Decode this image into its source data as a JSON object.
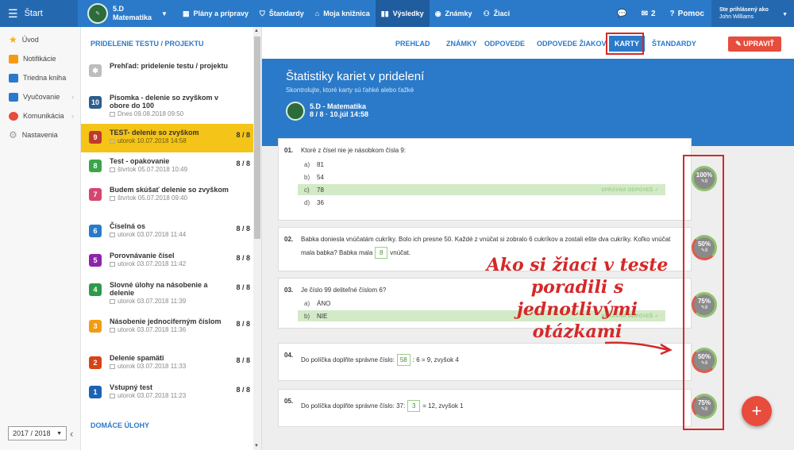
{
  "topbar": {
    "start_label": "Štart",
    "class_name": "5.D",
    "class_subject": "Matematika",
    "nav": [
      {
        "label": "Plány a prípravy",
        "icon": "calendar-icon"
      },
      {
        "label": "Štandardy",
        "icon": "shield-icon"
      },
      {
        "label": "Moja knižnica",
        "icon": "library-icon"
      },
      {
        "label": "Výsledky",
        "icon": "bar-chart-icon",
        "active": true
      },
      {
        "label": "Známky",
        "icon": "grade-icon"
      },
      {
        "label": "Žiaci",
        "icon": "students-icon"
      }
    ],
    "messages_count": "2",
    "help_label": "Pomoc",
    "user_caption": "Ste prihlásený ako",
    "user_name": "John Williams"
  },
  "sidebar": {
    "items": [
      {
        "label": "Úvod",
        "icon": "star-icon",
        "color": "#f5b400"
      },
      {
        "label": "Notifikácie",
        "icon": "envelope-icon",
        "color": "#f39c12"
      },
      {
        "label": "Triedna kniha",
        "icon": "book-icon",
        "color": "#2b7ac9"
      },
      {
        "label": "Vyučovanie",
        "icon": "teaching-icon",
        "color": "#2b7ac9",
        "arrow": "›"
      },
      {
        "label": "Komunikácia",
        "icon": "chat-icon",
        "color": "#e74c3c",
        "arrow": "›"
      },
      {
        "label": "Nastavenia",
        "icon": "gear-icon",
        "color": "#999999"
      }
    ],
    "year": "2017 / 2018"
  },
  "assignments": {
    "heading": "PRIDELENIE TESTU / PROJEKTU",
    "items": [
      {
        "badge": "",
        "color": "#bdbdbd",
        "title": "Prehľad: pridelenie testu / projektu",
        "date": "",
        "score": ""
      },
      {
        "badge": "10",
        "color": "#2c5e8f",
        "title": "Písomka - delenie so zvyškom v obore do 100",
        "date": "Dnes 09.08.2018 09:50",
        "score": ""
      },
      {
        "badge": "9",
        "color": "#c0392b",
        "title": "TEST- delenie so zvyškom",
        "date": "utorok 10.07.2018 14:58",
        "score": "8 / 8",
        "selected": true
      },
      {
        "badge": "8",
        "color": "#3aa64a",
        "title": "Test - opakovanie",
        "date": "štvrtok 05.07.2018 10:49",
        "score": "8 / 8"
      },
      {
        "badge": "7",
        "color": "#d6456f",
        "title": "Budem skúšať delenie so zvyškom",
        "date": "štvrtok 05.07.2018 09:40",
        "score": ""
      },
      {
        "badge": "6",
        "color": "#2b7ac9",
        "title": "Číselná os",
        "date": "utorok 03.07.2018 11:44",
        "score": "8 / 8"
      },
      {
        "badge": "5",
        "color": "#8e24aa",
        "title": "Porovnávanie čísel",
        "date": "utorok 03.07.2018 11:42",
        "score": "8 / 8"
      },
      {
        "badge": "4",
        "color": "#2e9a4a",
        "title": "Slovné úlohy na násobenie a delenie",
        "date": "utorok 03.07.2018 11:39",
        "score": "8 / 8"
      },
      {
        "badge": "3",
        "color": "#f39c12",
        "title": "Násobenie jednociferným číslom",
        "date": "utorok 03.07.2018 11:36",
        "score": "8 / 8"
      },
      {
        "badge": "2",
        "color": "#d84315",
        "title": "Delenie spamäti",
        "date": "utorok 03.07.2018 11:33",
        "score": "8 / 8"
      },
      {
        "badge": "1",
        "color": "#1e63b3",
        "title": "Vstupný test",
        "date": "utorok 03.07.2018 11:23",
        "score": "8 / 8"
      }
    ],
    "heading2": "DOMÁCE ÚLOHY"
  },
  "tabs": {
    "items": [
      "PREHĽAD",
      "ZNÁMKY",
      "ODPOVEDE",
      "ODPOVEDE ŽIAKOV",
      "KARTY",
      "ŠTANDARDY"
    ],
    "active": "KARTY",
    "edit_label": "UPRAVIŤ"
  },
  "header": {
    "title": "Štatistiky kariet v pridelení",
    "subtitle": "Skontrolujte, ktoré karty sú ťahké alebo ťažké",
    "class_line": "5.D - Matematika",
    "meta_line": "8 / 8 · 10.júl 14:58"
  },
  "questions": [
    {
      "num": "01.",
      "text": "Ktoré z čísel nie je násobkom čísla 9:",
      "options": [
        {
          "letter": "a)",
          "value": "81"
        },
        {
          "letter": "b)",
          "value": "54"
        },
        {
          "letter": "c)",
          "value": "78",
          "correct": true
        },
        {
          "letter": "d)",
          "value": "36"
        }
      ],
      "stat": "100%",
      "count": "8"
    },
    {
      "num": "02.",
      "text_before": "Babka doniesla vnúčatám cukríky. Bolo ich presne 50. Každé z vnúčat si zobralo 6 cukríkov a zostali ešte dva cukríky. Koľko vnúčat mala babka? Babka mala",
      "answer": "8",
      "text_after": "vnúčat.",
      "stat": "50%",
      "count": "8"
    },
    {
      "num": "03.",
      "text": "Je číslo 99 deliteľné číslom 6?",
      "options": [
        {
          "letter": "a)",
          "value": "ÁNO"
        },
        {
          "letter": "b)",
          "value": "NIE",
          "correct": true
        }
      ],
      "stat": "75%",
      "count": "8"
    },
    {
      "num": "04.",
      "text_before": "Do políčka doplňte správne číslo:",
      "answer": "58",
      "text_after": ": 6 = 9, zvyšok 4",
      "stat": "50%",
      "count": "8"
    },
    {
      "num": "05.",
      "text_before": "Do políčka doplňte správne číslo: 37:",
      "answer": "3",
      "text_after": "= 12, zvyšok 1",
      "stat": "75%",
      "count": "8"
    }
  ],
  "correct_label": "SPRÁVNA ODPOVEĎ",
  "annotation": {
    "line1": "Ako si žiaci v teste",
    "line2": "poradili s jednotlivými",
    "line3": "otázkami"
  },
  "fab_label": "+",
  "colors": {
    "primary": "#2b7ac9",
    "accent": "#e74c3c",
    "highlight": "#f4c418",
    "correct": "#d3eac7"
  }
}
